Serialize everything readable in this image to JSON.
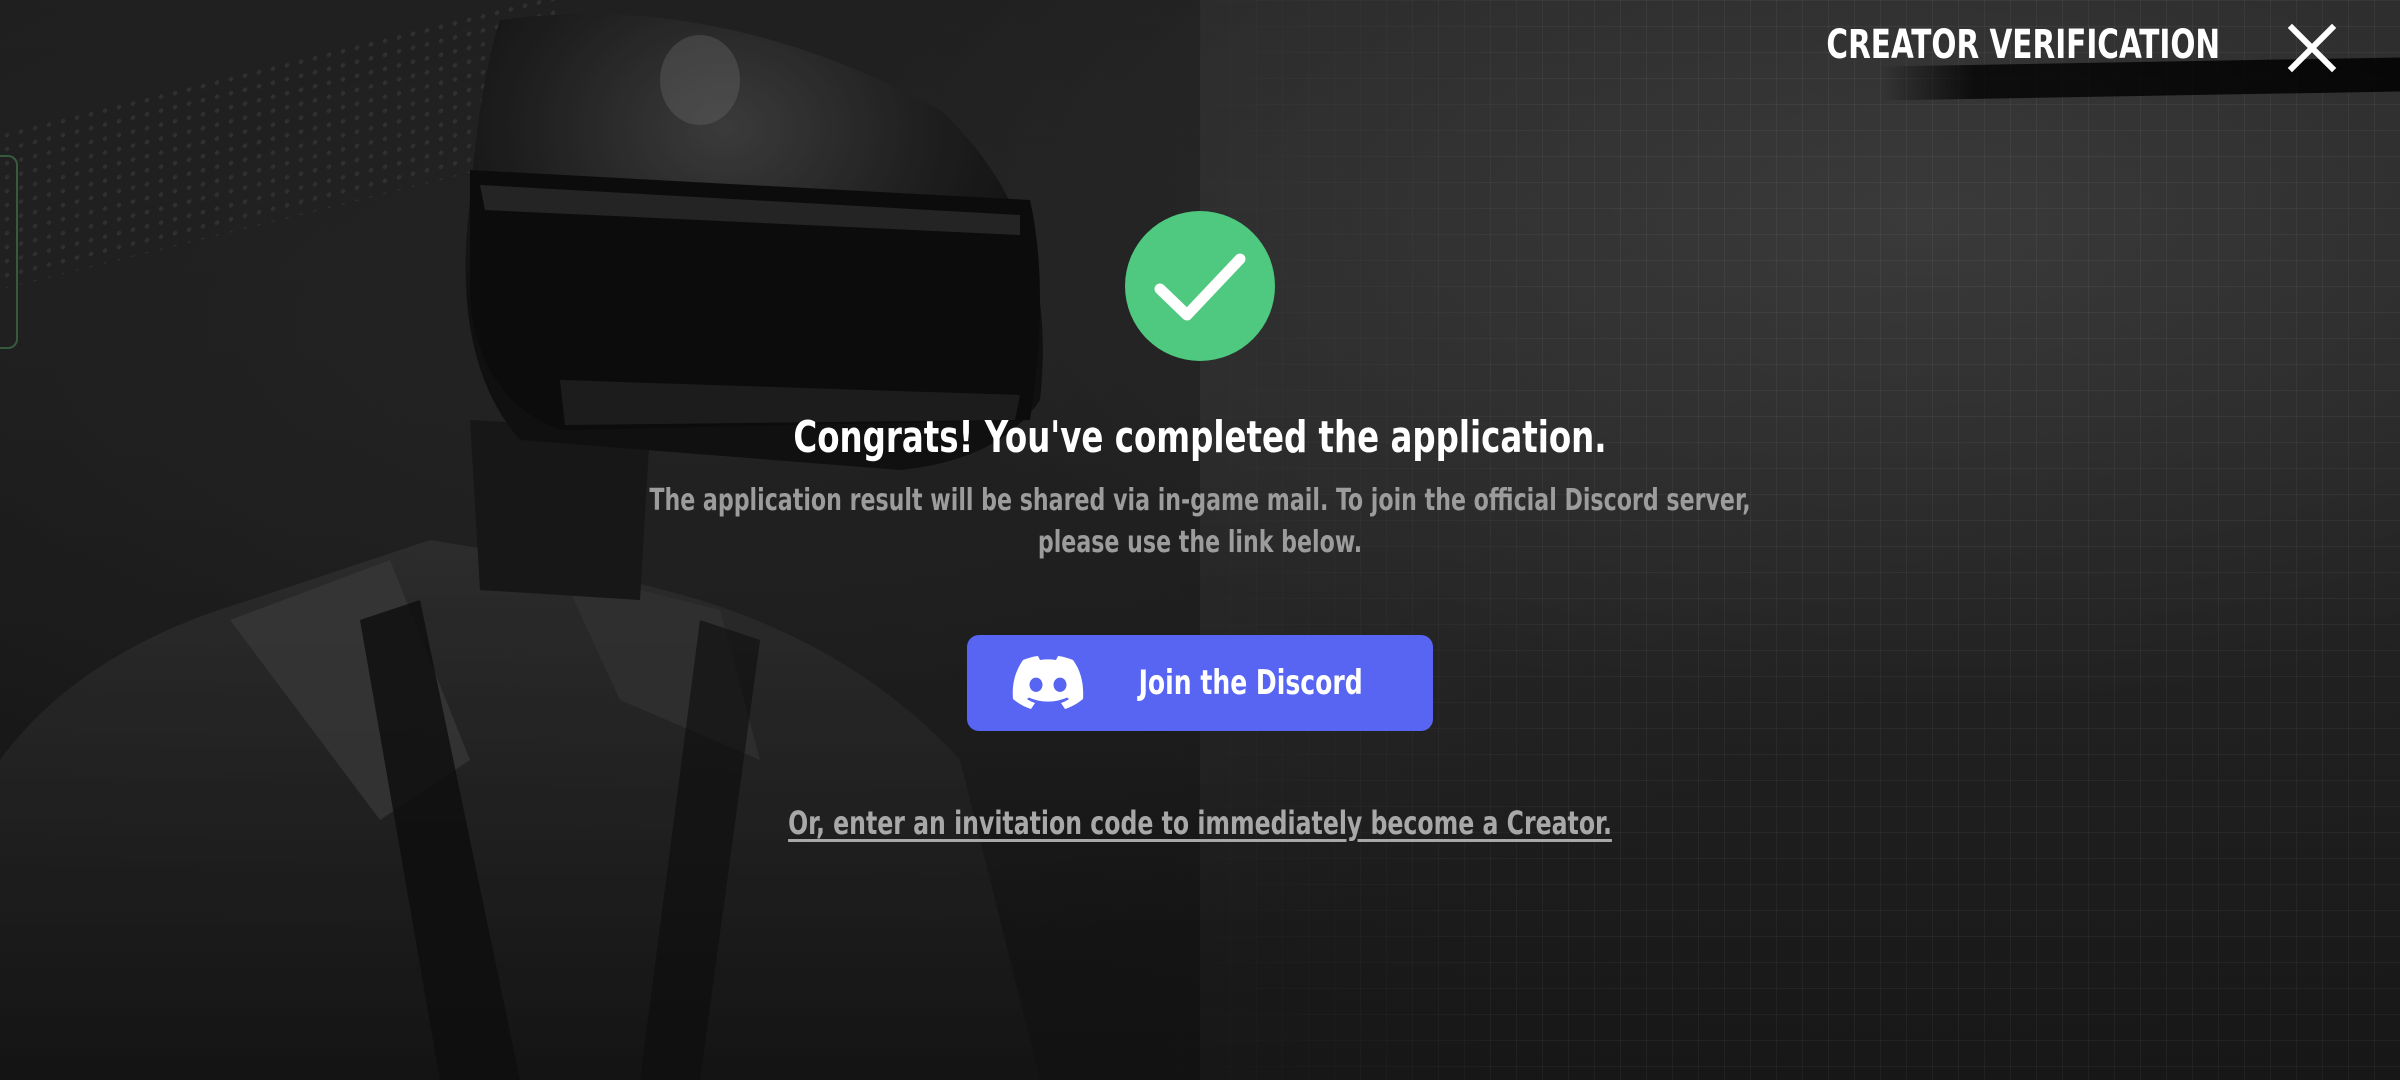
{
  "header": {
    "title": "CREATOR VERIFICATION",
    "close_icon": "close-icon"
  },
  "status": {
    "icon": "check-circle-icon",
    "icon_color": "#4ec97f",
    "headline": "Congrats! You've completed the application.",
    "description": "The application result will be shared via in-game mail. To join the official Discord server, please use the link below."
  },
  "discord": {
    "label": "Join the Discord",
    "icon": "discord-icon",
    "color": "#5865f2"
  },
  "invite": {
    "link_text": "Or, enter an invitation code to immediately become a Creator."
  }
}
